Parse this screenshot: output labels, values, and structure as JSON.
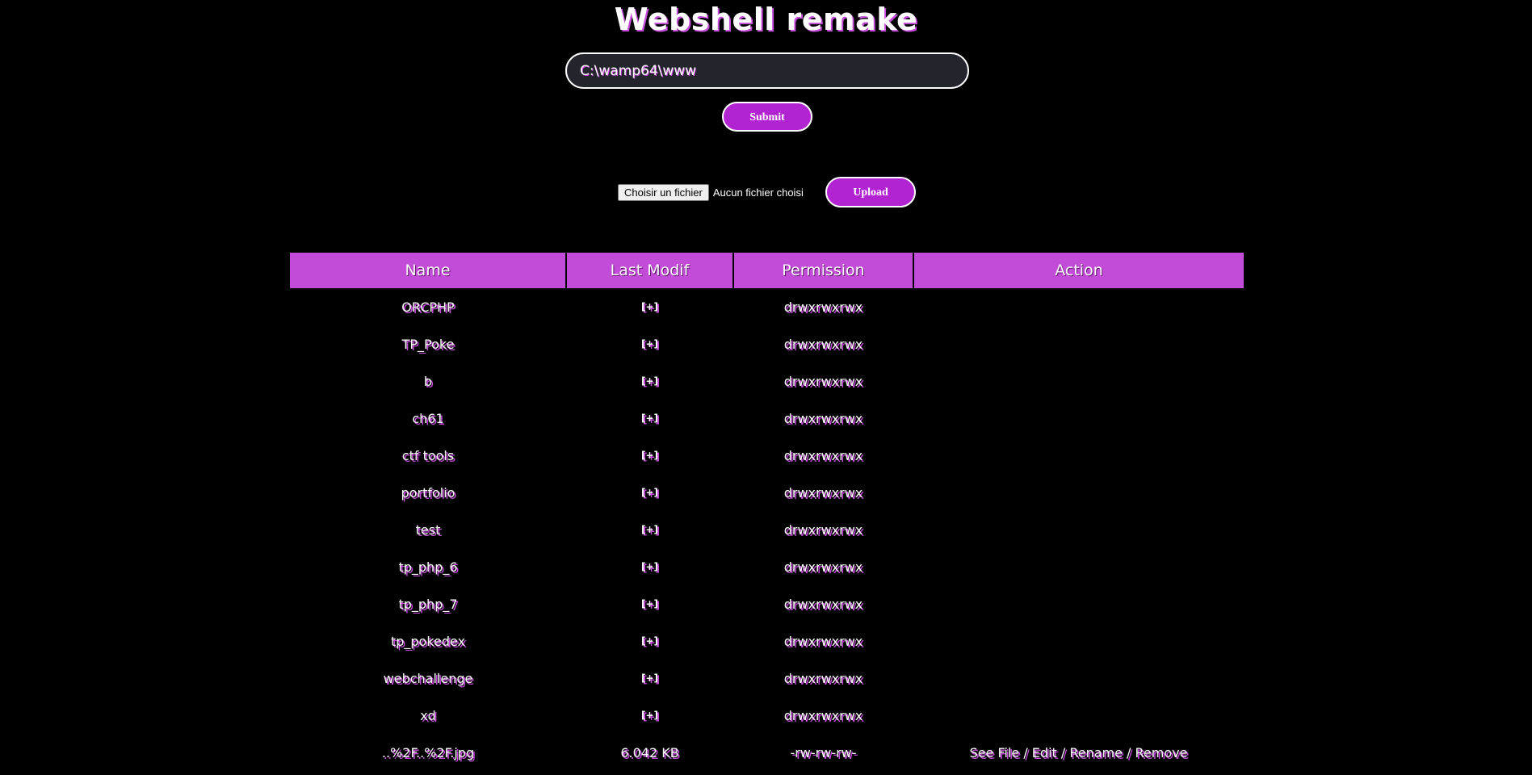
{
  "header": {
    "title": "Webshell remake"
  },
  "path_form": {
    "path_value": "C:\\wamp64\\www",
    "submit_label": "Submit"
  },
  "upload_form": {
    "choose_file_label": "Choisir un fichier",
    "no_file_text": "Aucun fichier choisi",
    "upload_label": "Upload"
  },
  "table": {
    "columns": [
      "Name",
      "Last Modif",
      "Permission",
      "Action"
    ],
    "rows": [
      {
        "name": "ORCPHP",
        "modif": "[+]",
        "permission": "drwxrwxrwx"
      },
      {
        "name": "TP_Poke",
        "modif": "[+]",
        "permission": "drwxrwxrwx"
      },
      {
        "name": "b",
        "modif": "[+]",
        "permission": "drwxrwxrwx"
      },
      {
        "name": "ch61",
        "modif": "[+]",
        "permission": "drwxrwxrwx"
      },
      {
        "name": "ctf tools",
        "modif": "[+]",
        "permission": "drwxrwxrwx"
      },
      {
        "name": "portfolio",
        "modif": "[+]",
        "permission": "drwxrwxrwx"
      },
      {
        "name": "test",
        "modif": "[+]",
        "permission": "drwxrwxrwx"
      },
      {
        "name": "tp_php_6",
        "modif": "[+]",
        "permission": "drwxrwxrwx"
      },
      {
        "name": "tp_php_7",
        "modif": "[+]",
        "permission": "drwxrwxrwx"
      },
      {
        "name": "tp_pokedex",
        "modif": "[+]",
        "permission": "drwxrwxrwx"
      },
      {
        "name": "webchallenge",
        "modif": "[+]",
        "permission": "drwxrwxrwx"
      },
      {
        "name": "xd",
        "modif": "[+]",
        "permission": "drwxrwxrwx"
      },
      {
        "name": "..%2F..%2F.jpg",
        "modif": "6.042 KB",
        "permission": "-rw-rw-rw-",
        "actions": {
          "see_file": "See File",
          "edit": "Edit",
          "rename": "Rename",
          "remove": "Remove",
          "separator": " / "
        }
      }
    ]
  },
  "colors": {
    "background": "#000000",
    "accent": "#b223d2",
    "header_bg": "#c24bd8",
    "glow": "#c24bd8",
    "input_bg": "#24242c"
  }
}
